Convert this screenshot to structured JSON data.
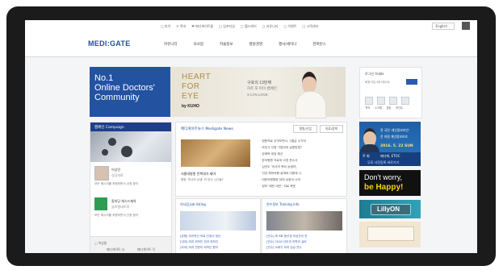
{
  "topbar": {
    "links": [
      "□ 마이",
      "✐ 쪽지",
      "❤ 메디게이트몰",
      "□ 심포지엄",
      "□ 헬스케어",
      "□ 커뮤니티",
      "□ 이벤트",
      "□ 고객센터"
    ],
    "language": "English",
    "search_icon": "search-icon"
  },
  "nav": {
    "logo": "MEDI:GATE",
    "menu": [
      "커뮤니티",
      "의사잡",
      "학술정보",
      "병원경영",
      "행사/세미나",
      "컨퍼런스"
    ]
  },
  "hero": {
    "line1": "No.1",
    "line2": "Online Doctors'",
    "line3": "Community"
  },
  "ad": {
    "line1": "HEART",
    "line2": "FOR",
    "line3": "EYE",
    "brand": "by KUHO",
    "copy1": "구호의 13번째",
    "copy2": "하트 포 아이 캠페인",
    "copy3": "X LYN LOVE"
  },
  "campaign": {
    "header": "캠페인 Campaign",
    "person_name": "이상민",
    "person_role": "성공의료",
    "person_desc": "모든 헤시지를 후원하면서 산정 환자",
    "partner_name": "중외당 헤스드제약",
    "partner_role": "글로벌네트워",
    "partner_desc": "모든 헤시지를 후원하면서 산정 환자",
    "footer_col1": "□ 여성들",
    "footer_item1": "메디게이트 사",
    "footer_item2": "메디게이트 닥"
  },
  "news": {
    "title": "메디게이트뉴스 Medigate News",
    "tab1": "병원/산업",
    "tab2": "의료/정책",
    "image_caption": "서울대병원 전북대가 재야",
    "image_sub": "병원 '의사의 상생' 의 방식 시간들?",
    "headlines": [
      "· 청원격료 무엇보면서, 1월급 수가하",
      "· 보호식 인증 기업외과 설명방법?",
      "· 장애북 대장 확산",
      "· 한국병원 의료외 사업 준수사",
      "· 심전도 '의사의 책외 상생하',",
      "· 건강 해외여행 설계와 이용에 나",
      "· 대한의원협회 대외 남중국 시작",
      "· 정보 '패턴 대란', 외료 목표"
    ]
  },
  "job": {
    "title": "의사잡 Job listing",
    "lines": [
      "[성형] 외과적인 의료 인정서 정신",
      "[내과] 외과 외적인 외과 외적인",
      "[외과] 외과 전문의 외적인 원칙"
    ]
  },
  "train": {
    "title": "연수정보 Training info",
    "lines": [
      "[연수] 제 9회 종신경 외상관리 연",
      "[연수] 2016 다이과 의학과 실버",
      "[연수] 소화기 외과 임상 연수"
    ]
  },
  "login": {
    "welcome": "로그인 하세요",
    "sub": "회원가입 메디게이트",
    "labels": [
      "쪽지",
      "스크랩",
      "알림",
      "포인트"
    ]
  },
  "banner1": {
    "line1": "전 국민 '개인정보보안'",
    "line2": "전 의원 개인정보보호",
    "date": "2016. 5. 22 SUN",
    "strip1": "주 최",
    "strip2": "메디케, ETOC",
    "strip3": "무료 사전등록 바로가기"
  },
  "banner2": {
    "word1": "Don't worry,",
    "word2": "be Happy!"
  },
  "banner3": {
    "label": "LillyON"
  }
}
